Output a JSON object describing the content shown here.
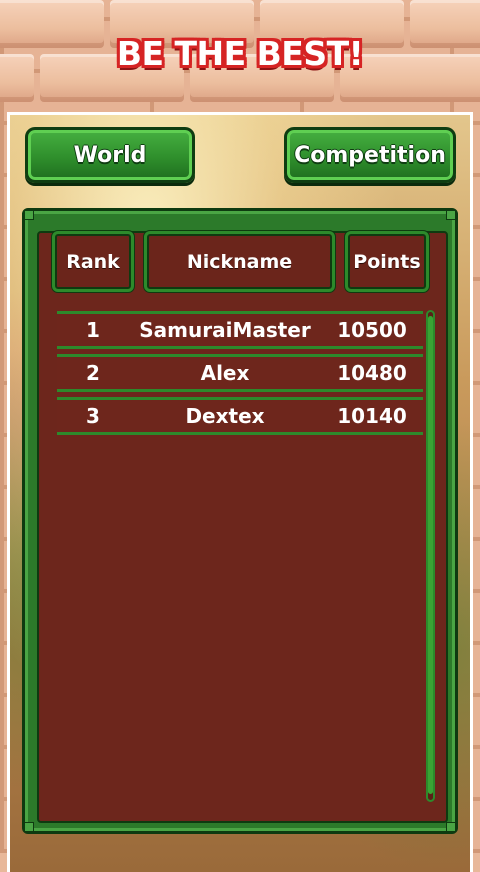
{
  "header": {
    "title": "BE THE BEST!"
  },
  "tabs": [
    {
      "label": "World"
    },
    {
      "label": "Competition"
    }
  ],
  "table": {
    "columns": [
      "Rank",
      "Nickname",
      "Points"
    ],
    "rows": [
      {
        "rank": "1",
        "nickname": "SamuraiMaster",
        "points": "10500"
      },
      {
        "rank": "2",
        "nickname": "Alex",
        "points": "10480"
      },
      {
        "rank": "3",
        "nickname": "Dextex",
        "points": "10140"
      }
    ]
  },
  "colors": {
    "title_outline": "#d62424",
    "button_green": "#2f8f2c",
    "panel_brown": "#6d261c"
  }
}
